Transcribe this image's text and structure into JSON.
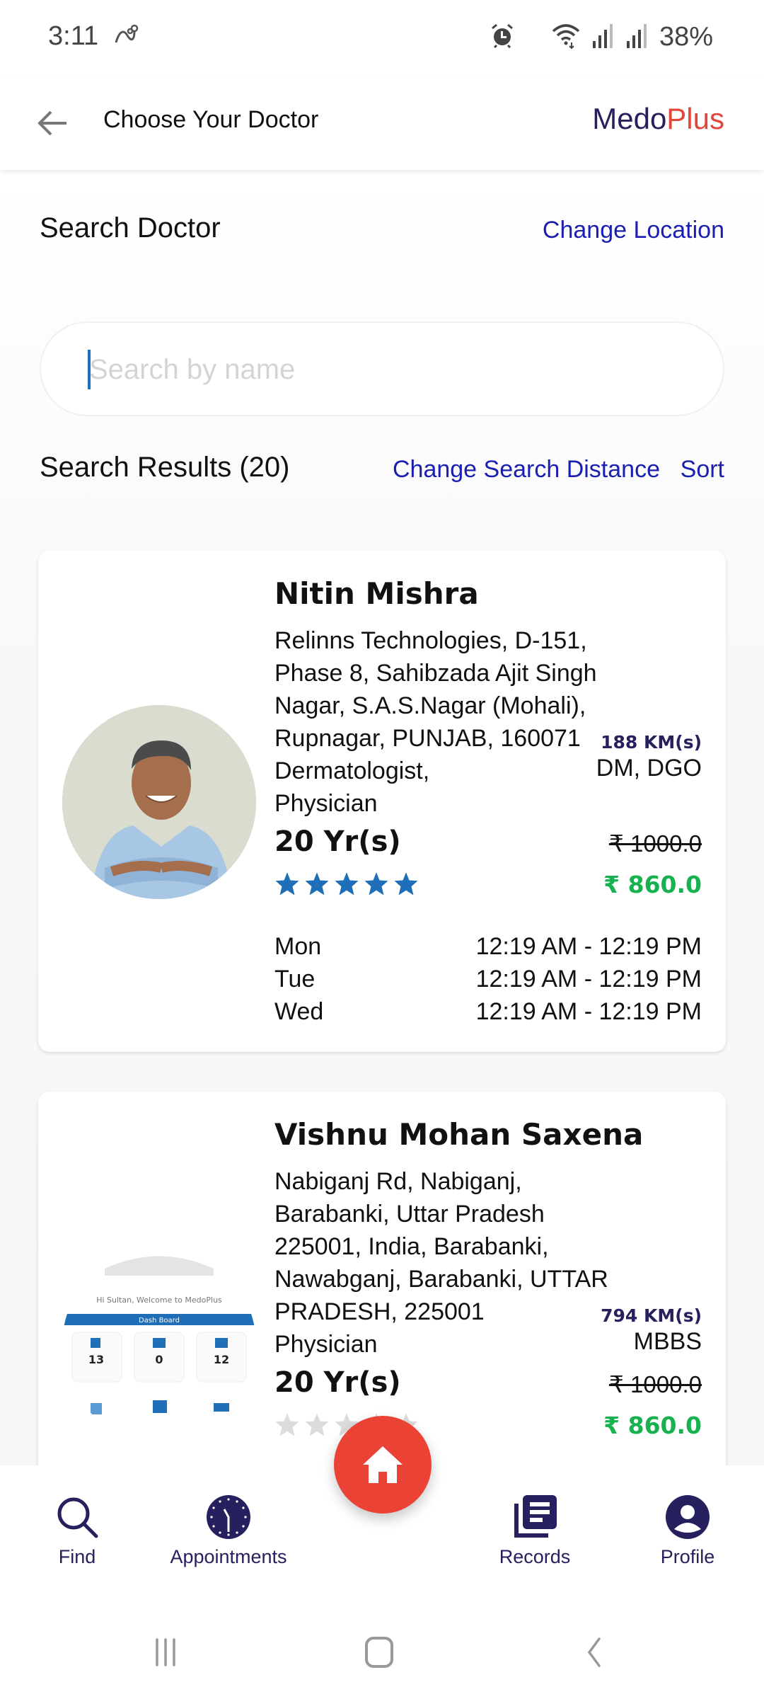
{
  "status_bar": {
    "time": "3:11",
    "battery": "38%",
    "icons": [
      "link-icon",
      "alarm-icon",
      "wifi-icon",
      "signal-icon",
      "signal-icon"
    ]
  },
  "app_bar": {
    "title": "Choose Your Doctor",
    "brand_part1": "Medo",
    "brand_part2": "Plus",
    "brand_colors": {
      "primary": "#26215e",
      "accent": "#e0463a"
    }
  },
  "search_section": {
    "title": "Search Doctor",
    "change_location": "Change Location",
    "search_placeholder": "Search by name",
    "search_value": ""
  },
  "results": {
    "title": "Search Results (20)",
    "change_distance": "Change Search Distance",
    "sort": "Sort",
    "doctors": [
      {
        "name": "Nitin Mishra",
        "address": "Relinns Technologies, D-151, Phase 8, Sahibzada Ajit Singh Nagar, S.A.S.Nagar (Mohali), Rupnagar, PUNJAB, 160071",
        "distance": "188 KM(s)",
        "specialization": "Dermatologist, Physician",
        "qualification": "DM, DGO",
        "experience": "20 Yr(s)",
        "price_original": "₹ 1000.0",
        "price_discounted": "₹ 860.0",
        "rating": 5,
        "rating_max": 5,
        "schedule": [
          {
            "day": "Mon",
            "time": "12:19 AM - 12:19 PM"
          },
          {
            "day": "Tue",
            "time": "12:19 AM - 12:19 PM"
          },
          {
            "day": "Wed",
            "time": "12:19 AM - 12:19 PM"
          }
        ]
      },
      {
        "name": "Vishnu Mohan Saxena",
        "address": "Nabiganj Rd, Nabiganj, Barabanki, Uttar Pradesh 225001, India, Barabanki, Nawabganj, Barabanki, UTTAR PRADESH, 225001",
        "distance": "794 KM(s)",
        "specialization": "Physician",
        "qualification": "MBBS",
        "experience": "20 Yr(s)",
        "price_original": "₹ 1000.0",
        "price_discounted": "₹ 860.0",
        "rating": 0,
        "rating_max": 5,
        "avatar_caption": "Hi Sultan, Welcome to MedoPlus",
        "avatar_banner": "Dash Board",
        "avatar_stats": [
          "13",
          "0",
          "12"
        ]
      }
    ]
  },
  "colors": {
    "star_filled": "#1f6fb8",
    "star_empty": "#dcdcdc",
    "price_green": "#17b24f",
    "fab_red": "#ea4335",
    "nav_navy": "#26215e",
    "link_blue": "#1a1fb0"
  },
  "bottom_nav": {
    "items": [
      {
        "label": "Find",
        "icon": "search-icon"
      },
      {
        "label": "Appointments",
        "icon": "clock-icon"
      },
      {
        "label": "Records",
        "icon": "records-icon"
      },
      {
        "label": "Profile",
        "icon": "profile-icon"
      }
    ],
    "fab_icon": "home-icon"
  },
  "system_nav": {
    "buttons": [
      "recents-icon",
      "home-icon",
      "back-icon"
    ]
  }
}
